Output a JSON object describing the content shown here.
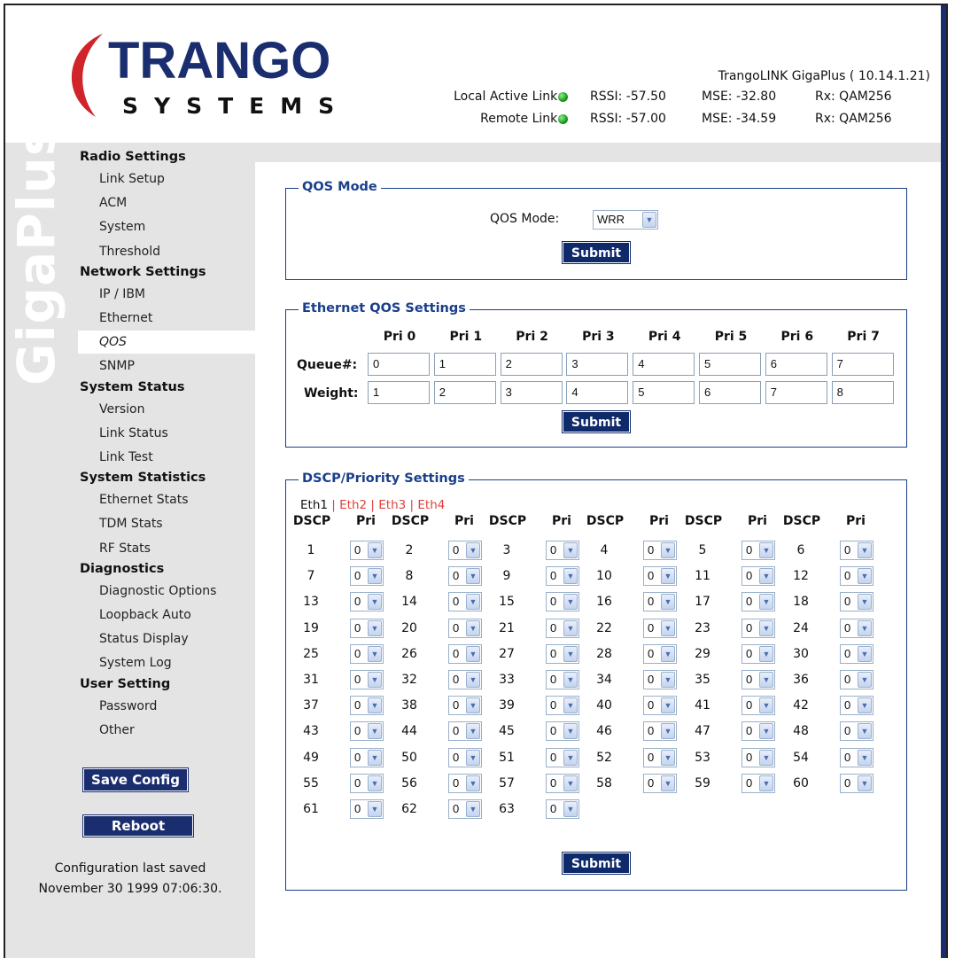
{
  "header": {
    "brand_main": "TRANGO",
    "brand_sub": "SYSTEMS",
    "device_title": "TrangoLINK GigaPlus ( 10.14.1.21)",
    "links": [
      {
        "label": "Local Active Link:",
        "rssi": "RSSI: -57.50",
        "mse": "MSE: -32.80",
        "rx": "Rx: QAM256"
      },
      {
        "label": "Remote Link:",
        "rssi": "RSSI: -57.00",
        "mse": "MSE: -34.59",
        "rx": "Rx: QAM256"
      }
    ]
  },
  "sidebar": {
    "watermark": "GigaPlus",
    "sections": [
      {
        "heading": "Radio Settings",
        "items": [
          "Link Setup",
          "ACM",
          "System",
          "Threshold"
        ]
      },
      {
        "heading": "Network Settings",
        "items": [
          "IP / IBM",
          "Ethernet",
          "QOS",
          "SNMP"
        ]
      },
      {
        "heading": "System Status",
        "items": [
          "Version",
          "Link Status",
          "Link Test"
        ]
      },
      {
        "heading": "System Statistics",
        "items": [
          "Ethernet Stats",
          "TDM Stats",
          "RF Stats"
        ]
      },
      {
        "heading": "Diagnostics",
        "items": [
          "Diagnostic Options",
          "Loopback Auto",
          "Status Display",
          "System Log"
        ]
      },
      {
        "heading": "User Setting",
        "items": [
          "Password",
          "Other"
        ]
      }
    ],
    "active_item": "QOS",
    "save_label": "Save Config",
    "reboot_label": "Reboot",
    "saved_line1": "Configuration last saved",
    "saved_line2": "November 30 1999 07:06:30."
  },
  "qos_mode": {
    "legend": "QOS Mode",
    "label": "QOS Mode:",
    "value": "WRR",
    "submit": "Submit"
  },
  "eth_qos": {
    "legend": "Ethernet QOS Settings",
    "headers": [
      "Pri 0",
      "Pri 1",
      "Pri 2",
      "Pri 3",
      "Pri 4",
      "Pri 5",
      "Pri 6",
      "Pri 7"
    ],
    "queue_label": "Queue#:",
    "queue": [
      "0",
      "1",
      "2",
      "3",
      "4",
      "5",
      "6",
      "7"
    ],
    "weight_label": "Weight:",
    "weight": [
      "1",
      "2",
      "3",
      "4",
      "5",
      "6",
      "7",
      "8"
    ],
    "submit": "Submit"
  },
  "dscp": {
    "legend": "DSCP/Priority Settings",
    "tabs": [
      "Eth1",
      "Eth2",
      "Eth3",
      "Eth4"
    ],
    "separator": "|",
    "col_dscp": "DSCP",
    "col_pri": "Pri",
    "default_pri": "0",
    "count": 64,
    "submit": "Submit"
  },
  "colors": {
    "navy": "#1a2d6e",
    "fieldset": "#1a3f8a",
    "link_red": "#e0403c",
    "logo_red": "#d0232a",
    "led_green": "#1a9a1a"
  }
}
